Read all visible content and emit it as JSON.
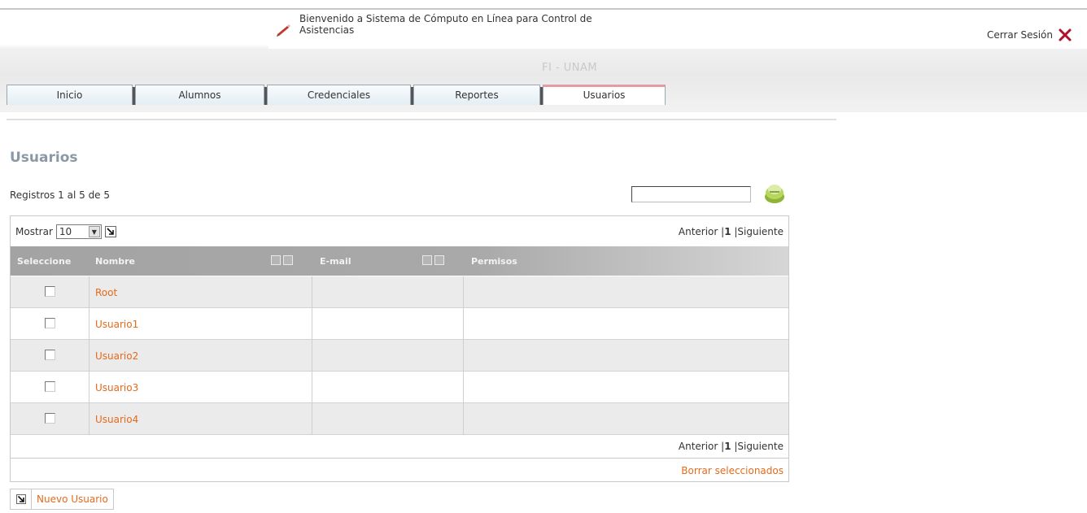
{
  "header": {
    "welcome_text": "Bienvenido a Sistema de Cómputo en Línea para Control de Asistencias",
    "logout_label": "Cerrar Sesión",
    "site_subtitle": "FI - UNAM"
  },
  "tabs": [
    {
      "label": "Inicio",
      "active": false
    },
    {
      "label": "Alumnos",
      "active": false
    },
    {
      "label": "Credenciales",
      "active": false
    },
    {
      "label": "Reportes",
      "active": false
    },
    {
      "label": "Usuarios",
      "active": true
    }
  ],
  "page": {
    "title": "Usuarios",
    "records_text": "Registros 1 al 5 de 5",
    "search_value": ""
  },
  "grid": {
    "show_label": "Mostrar",
    "show_value": "10",
    "pager": {
      "prev": "Anterior",
      "sep1": " |",
      "page": "1",
      "sep2": " |",
      "next": "Siguiente"
    },
    "columns": {
      "select": "Seleccione",
      "name": "Nombre",
      "email": "E-mail",
      "perms": "Permisos"
    },
    "rows": [
      {
        "name": "Root",
        "email": "",
        "perms": ""
      },
      {
        "name": "Usuario1",
        "email": "",
        "perms": ""
      },
      {
        "name": "Usuario2",
        "email": "",
        "perms": ""
      },
      {
        "name": "Usuario3",
        "email": "",
        "perms": ""
      },
      {
        "name": "Usuario4",
        "email": "",
        "perms": ""
      }
    ],
    "delete_label": "Borrar seleccionados"
  },
  "actions": {
    "new_user_label": "Nuevo Usuario"
  },
  "colors": {
    "link_orange": "#e46a1c",
    "title_gray": "#8b98a6",
    "active_tab_accent": "#e59aa4"
  }
}
